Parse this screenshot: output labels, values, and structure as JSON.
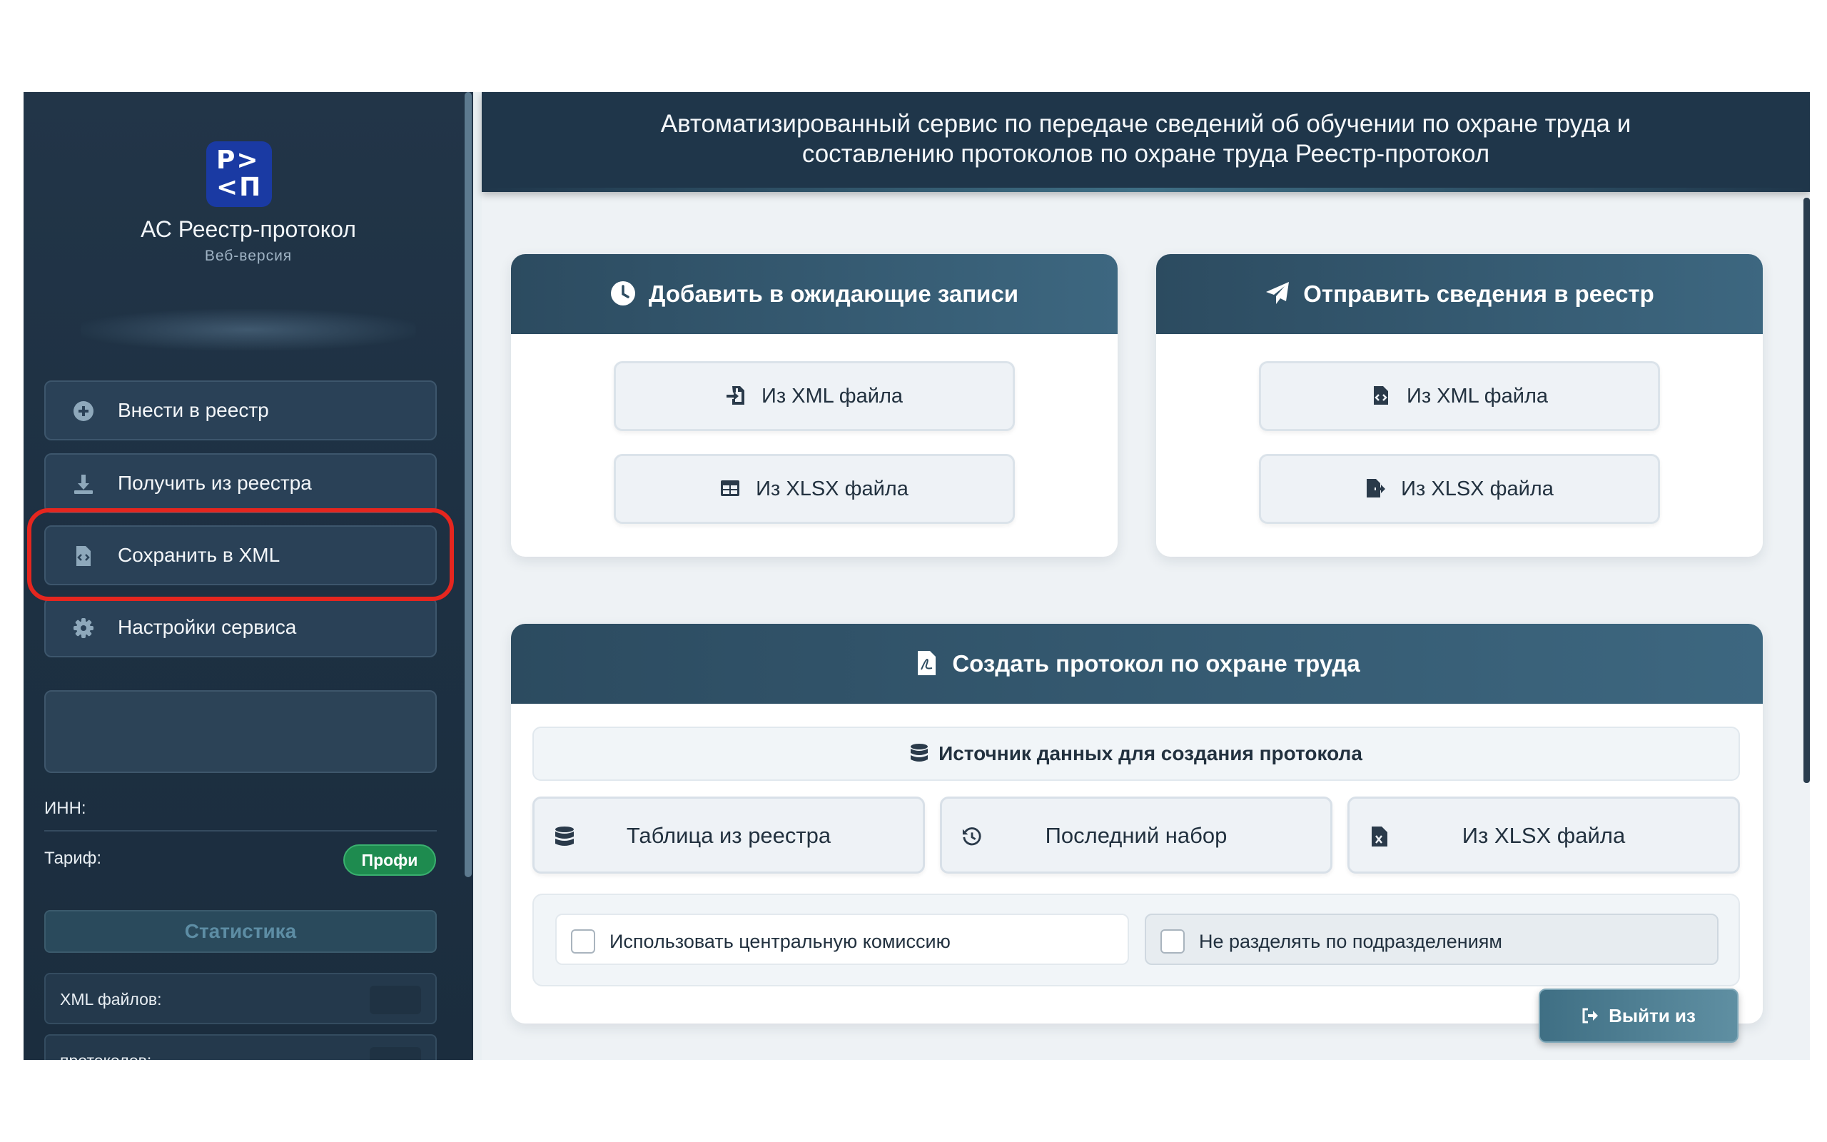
{
  "header": {
    "title_line1": "Автоматизированный сервис по передаче сведений об обучении по охране труда и",
    "title_line2": "составлению протоколов по охране труда Реестр-протокол"
  },
  "sidebar": {
    "logo_line1": "Р>",
    "logo_line2": "<П",
    "app_title": "АС Реестр-протокол",
    "app_subtitle": "Веб-версия",
    "items": [
      {
        "label": "Внести в реестр",
        "icon": "plus-circle-icon"
      },
      {
        "label": "Получить из реестра",
        "icon": "download-icon"
      },
      {
        "label": "Сохранить в XML",
        "icon": "file-code-icon"
      },
      {
        "label": "Настройки сервиса",
        "icon": "gear-icon"
      }
    ],
    "inn_label": "ИНН:",
    "tariff_label": "Тариф:",
    "tariff_value": "Профи",
    "stats_title": "Статистика",
    "stats": [
      {
        "label": "XML файлов:"
      },
      {
        "label": "протоколов:"
      }
    ]
  },
  "cards": {
    "pending": {
      "title": "Добавить в ожидающие записи",
      "icon": "clock-icon",
      "buttons": [
        {
          "label": "Из XML файла",
          "icon": "file-import-icon"
        },
        {
          "label": "Из XLSX файла",
          "icon": "table-icon"
        }
      ]
    },
    "send": {
      "title": "Отправить сведения в реестр",
      "icon": "paper-plane-icon",
      "buttons": [
        {
          "label": "Из XML файла",
          "icon": "file-code-icon"
        },
        {
          "label": "Из XLSX файла",
          "icon": "file-export-icon"
        }
      ]
    },
    "protocol": {
      "title": "Создать протокол по охране труда",
      "icon": "file-pdf-icon",
      "source_title": "Источник данных для создания протокола",
      "sources": [
        {
          "label": "Таблица из реестра",
          "icon": "database-icon"
        },
        {
          "label": "Последний набор",
          "icon": "history-icon"
        },
        {
          "label": "Из XLSX файла",
          "icon": "file-excel-icon"
        }
      ],
      "options": [
        {
          "label": "Использовать центральную комиссию",
          "checked": false
        },
        {
          "label": "Не разделять по подразделениям",
          "checked": false
        }
      ]
    }
  },
  "logout_label": "Выйти из системы",
  "colors": {
    "sidebar_bg": "#1f3243",
    "card_header": "#2c4b60",
    "accent_highlight": "#e5261f",
    "badge_green": "#1e8b4f"
  }
}
